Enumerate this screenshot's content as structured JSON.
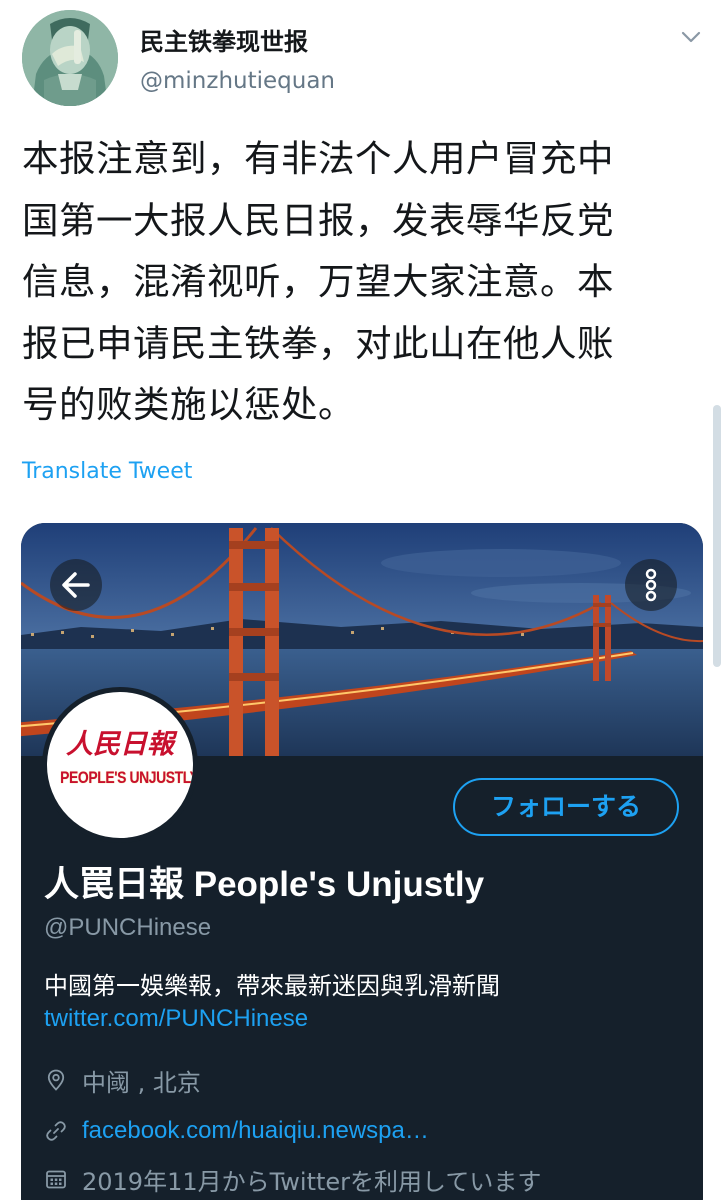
{
  "tweet": {
    "author": {
      "display_name": "民主铁拳现世报",
      "handle": "@minzhutiequan",
      "avatar": "avatar-image"
    },
    "text_lines": [
      "本报注意到，有非法个人用户冒充中",
      "国第一大报人民日报，发表辱华反党",
      "信息，混淆视听，万望大家注意。本",
      "报已申请民主铁拳，对此山在他人账",
      "号的败类施以惩处。"
    ],
    "translate_label": "Translate Tweet",
    "menu_icon": "chevron-down-icon"
  },
  "embedded_profile": {
    "back_icon": "arrow-left-icon",
    "more_icon": "more-vertical-icon",
    "logo": {
      "cjk_text": "人民日報",
      "en_text": "PEOPLE'S UNJUSTLY"
    },
    "follow_label": "フォローする",
    "name": "人罠日報 People's Unjustly",
    "handle": "@PUNCHinese",
    "bio": "中國第一娛樂報，帶來最新迷因與乳滑新聞",
    "bio_link": "twitter.com/PUNCHinese",
    "location": "中阈 , 北京",
    "website": "facebook.com/huaiqiu.newspa…",
    "joined": "2019年11月からTwitterを利用しています"
  },
  "colors": {
    "accent": "#1da1f2",
    "card_bg": "#15202b",
    "muted_text": "#8899a6",
    "logo_red": "#c8102e"
  }
}
